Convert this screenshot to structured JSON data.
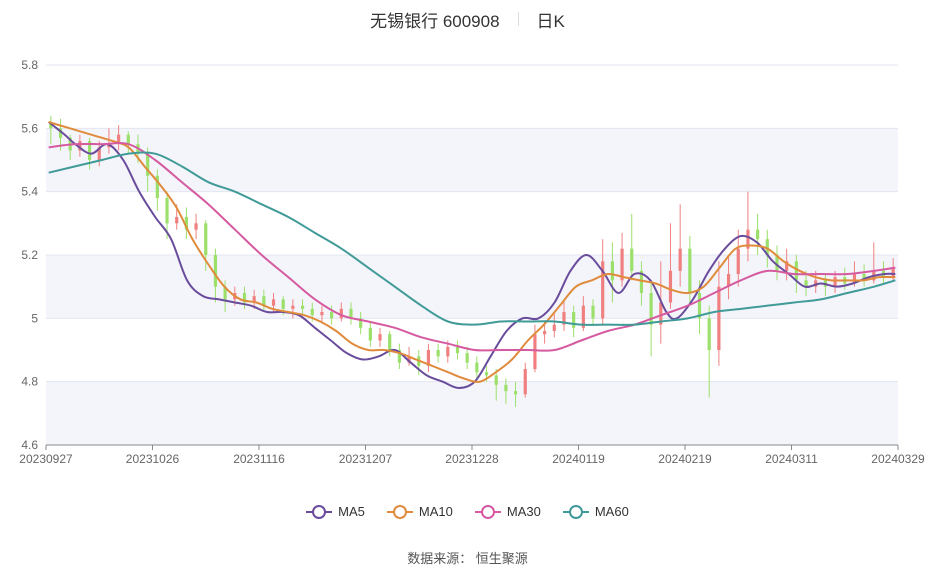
{
  "header": {
    "title": "无锡银行 600908",
    "period": "日K"
  },
  "source": "数据来源：  恒生聚源",
  "chart_data": {
    "type": "candlestick",
    "title": "无锡银行 600908",
    "period_label": "日K",
    "ylim": [
      4.6,
      5.8
    ],
    "y_ticks": [
      4.6,
      4.8,
      5,
      5.2,
      5.4,
      5.6,
      5.8
    ],
    "y_tick_labels": [
      "4.6",
      "4.8",
      "5",
      "5.2",
      "5.4",
      "5.6",
      "5.8"
    ],
    "x_tick_labels": [
      "20230927",
      "20231026",
      "20231116",
      "20231207",
      "20231228",
      "20240119",
      "20240219",
      "20240311",
      "20240329"
    ],
    "x_tick_indices": [
      0,
      20,
      40,
      60,
      80,
      100,
      120,
      140,
      159
    ],
    "grid": true,
    "legend_position": "bottom",
    "colors": {
      "up": "#f08080",
      "down": "#9be06a",
      "MA5": "#6a4c9c",
      "MA10": "#e08b3c",
      "MA30": "#d55aa0",
      "MA60": "#3f9a98"
    },
    "series": [
      {
        "name": "MA5",
        "values": [
          [
            0,
            5.62
          ],
          [
            3,
            5.58
          ],
          [
            5,
            5.55
          ],
          [
            8,
            5.52
          ],
          [
            11,
            5.55
          ],
          [
            14,
            5.5
          ],
          [
            17,
            5.4
          ],
          [
            20,
            5.32
          ],
          [
            23,
            5.25
          ],
          [
            26,
            5.12
          ],
          [
            29,
            5.07
          ],
          [
            32,
            5.06
          ],
          [
            35,
            5.05
          ],
          [
            38,
            5.04
          ],
          [
            41,
            5.02
          ],
          [
            44,
            5.02
          ],
          [
            47,
            5.01
          ],
          [
            50,
            4.97
          ],
          [
            53,
            4.93
          ],
          [
            56,
            4.89
          ],
          [
            59,
            4.87
          ],
          [
            62,
            4.88
          ],
          [
            65,
            4.9
          ],
          [
            68,
            4.86
          ],
          [
            71,
            4.82
          ],
          [
            74,
            4.8
          ],
          [
            77,
            4.78
          ],
          [
            80,
            4.8
          ],
          [
            83,
            4.88
          ],
          [
            86,
            4.96
          ],
          [
            89,
            5.0
          ],
          [
            92,
            5.0
          ],
          [
            95,
            5.05
          ],
          [
            98,
            5.15
          ],
          [
            101,
            5.2
          ],
          [
            104,
            5.15
          ],
          [
            107,
            5.08
          ],
          [
            110,
            5.14
          ],
          [
            113,
            5.12
          ],
          [
            116,
            5.02
          ],
          [
            118,
            5.0
          ],
          [
            121,
            5.06
          ],
          [
            124,
            5.15
          ],
          [
            127,
            5.22
          ],
          [
            130,
            5.26
          ],
          [
            133,
            5.24
          ],
          [
            136,
            5.18
          ],
          [
            139,
            5.14
          ],
          [
            142,
            5.1
          ],
          [
            145,
            5.11
          ],
          [
            148,
            5.1
          ],
          [
            151,
            5.11
          ],
          [
            154,
            5.13
          ],
          [
            157,
            5.14
          ],
          [
            159,
            5.14
          ]
        ]
      },
      {
        "name": "MA10",
        "values": [
          [
            0,
            5.62
          ],
          [
            4,
            5.6
          ],
          [
            8,
            5.58
          ],
          [
            12,
            5.56
          ],
          [
            15,
            5.54
          ],
          [
            18,
            5.48
          ],
          [
            21,
            5.42
          ],
          [
            24,
            5.35
          ],
          [
            27,
            5.25
          ],
          [
            30,
            5.17
          ],
          [
            33,
            5.1
          ],
          [
            36,
            5.06
          ],
          [
            39,
            5.05
          ],
          [
            42,
            5.03
          ],
          [
            45,
            5.02
          ],
          [
            48,
            5.01
          ],
          [
            51,
            4.99
          ],
          [
            54,
            4.96
          ],
          [
            57,
            4.92
          ],
          [
            60,
            4.9
          ],
          [
            63,
            4.9
          ],
          [
            66,
            4.89
          ],
          [
            69,
            4.87
          ],
          [
            72,
            4.85
          ],
          [
            75,
            4.83
          ],
          [
            78,
            4.81
          ],
          [
            81,
            4.8
          ],
          [
            84,
            4.83
          ],
          [
            87,
            4.87
          ],
          [
            90,
            4.93
          ],
          [
            93,
            4.98
          ],
          [
            96,
            5.04
          ],
          [
            99,
            5.1
          ],
          [
            102,
            5.12
          ],
          [
            105,
            5.14
          ],
          [
            108,
            5.13
          ],
          [
            111,
            5.12
          ],
          [
            114,
            5.11
          ],
          [
            117,
            5.09
          ],
          [
            120,
            5.08
          ],
          [
            123,
            5.1
          ],
          [
            126,
            5.16
          ],
          [
            129,
            5.22
          ],
          [
            132,
            5.23
          ],
          [
            135,
            5.22
          ],
          [
            138,
            5.18
          ],
          [
            141,
            5.15
          ],
          [
            144,
            5.13
          ],
          [
            147,
            5.12
          ],
          [
            150,
            5.12
          ],
          [
            153,
            5.12
          ],
          [
            156,
            5.13
          ],
          [
            159,
            5.13
          ]
        ]
      },
      {
        "name": "MA30",
        "values": [
          [
            0,
            5.54
          ],
          [
            5,
            5.55
          ],
          [
            10,
            5.55
          ],
          [
            15,
            5.55
          ],
          [
            20,
            5.5
          ],
          [
            25,
            5.43
          ],
          [
            30,
            5.36
          ],
          [
            35,
            5.28
          ],
          [
            40,
            5.2
          ],
          [
            45,
            5.13
          ],
          [
            50,
            5.06
          ],
          [
            55,
            5.01
          ],
          [
            60,
            4.99
          ],
          [
            65,
            4.97
          ],
          [
            70,
            4.94
          ],
          [
            75,
            4.92
          ],
          [
            80,
            4.9
          ],
          [
            85,
            4.9
          ],
          [
            90,
            4.9
          ],
          [
            95,
            4.9
          ],
          [
            100,
            4.93
          ],
          [
            105,
            4.96
          ],
          [
            110,
            4.98
          ],
          [
            115,
            5.01
          ],
          [
            120,
            5.04
          ],
          [
            125,
            5.08
          ],
          [
            130,
            5.12
          ],
          [
            135,
            5.15
          ],
          [
            140,
            5.14
          ],
          [
            145,
            5.14
          ],
          [
            150,
            5.14
          ],
          [
            155,
            5.15
          ],
          [
            159,
            5.16
          ]
        ]
      },
      {
        "name": "MA60",
        "values": [
          [
            0,
            5.46
          ],
          [
            10,
            5.5
          ],
          [
            15,
            5.52
          ],
          [
            20,
            5.52
          ],
          [
            25,
            5.48
          ],
          [
            30,
            5.43
          ],
          [
            35,
            5.4
          ],
          [
            40,
            5.36
          ],
          [
            45,
            5.32
          ],
          [
            50,
            5.27
          ],
          [
            55,
            5.22
          ],
          [
            60,
            5.16
          ],
          [
            65,
            5.1
          ],
          [
            70,
            5.04
          ],
          [
            75,
            4.99
          ],
          [
            80,
            4.98
          ],
          [
            85,
            4.99
          ],
          [
            90,
            4.99
          ],
          [
            95,
            4.99
          ],
          [
            100,
            4.98
          ],
          [
            105,
            4.98
          ],
          [
            110,
            4.98
          ],
          [
            115,
            4.99
          ],
          [
            120,
            5.0
          ],
          [
            125,
            5.02
          ],
          [
            130,
            5.03
          ],
          [
            135,
            5.04
          ],
          [
            140,
            5.05
          ],
          [
            145,
            5.06
          ],
          [
            150,
            5.08
          ],
          [
            155,
            5.1
          ],
          [
            159,
            5.12
          ]
        ]
      }
    ],
    "candles": [
      [
        5.62,
        5.6,
        5.64,
        5.55
      ],
      [
        5.6,
        5.57,
        5.63,
        5.53
      ],
      [
        5.57,
        5.53,
        5.58,
        5.5
      ],
      [
        5.53,
        5.56,
        5.58,
        5.51
      ],
      [
        5.56,
        5.5,
        5.57,
        5.47
      ],
      [
        5.5,
        5.54,
        5.56,
        5.48
      ],
      [
        5.54,
        5.55,
        5.6,
        5.52
      ],
      [
        5.55,
        5.58,
        5.61,
        5.53
      ],
      [
        5.58,
        5.55,
        5.59,
        5.52
      ],
      [
        5.55,
        5.52,
        5.58,
        5.49
      ],
      [
        5.52,
        5.45,
        5.54,
        5.4
      ],
      [
        5.45,
        5.38,
        5.47,
        5.34
      ],
      [
        5.38,
        5.3,
        5.4,
        5.25
      ],
      [
        5.3,
        5.32,
        5.36,
        5.28
      ],
      [
        5.32,
        5.28,
        5.35,
        5.25
      ],
      [
        5.28,
        5.3,
        5.33,
        5.25
      ],
      [
        5.3,
        5.2,
        5.31,
        5.15
      ],
      [
        5.2,
        5.1,
        5.22,
        5.05
      ],
      [
        5.1,
        5.06,
        5.12,
        5.02
      ],
      [
        5.06,
        5.08,
        5.1,
        5.04
      ],
      [
        5.08,
        5.05,
        5.1,
        5.03
      ],
      [
        5.05,
        5.07,
        5.09,
        5.03
      ],
      [
        5.07,
        5.04,
        5.09,
        5.02
      ],
      [
        5.04,
        5.06,
        5.08,
        5.02
      ],
      [
        5.06,
        5.03,
        5.07,
        5.01
      ],
      [
        5.03,
        5.04,
        5.06,
        5.0
      ],
      [
        5.04,
        5.03,
        5.06,
        5.01
      ],
      [
        5.03,
        5.01,
        5.05,
        4.99
      ],
      [
        5.01,
        5.02,
        5.04,
        4.99
      ],
      [
        5.02,
        5.0,
        5.04,
        4.98
      ],
      [
        5.0,
        5.03,
        5.05,
        4.99
      ],
      [
        5.03,
        5.0,
        5.05,
        4.98
      ],
      [
        5.0,
        4.97,
        5.02,
        4.95
      ],
      [
        4.97,
        4.93,
        4.99,
        4.91
      ],
      [
        4.93,
        4.95,
        4.97,
        4.91
      ],
      [
        4.95,
        4.9,
        4.96,
        4.88
      ],
      [
        4.9,
        4.86,
        4.92,
        4.84
      ],
      [
        4.86,
        4.88,
        4.91,
        4.85
      ],
      [
        4.88,
        4.85,
        4.9,
        4.82
      ],
      [
        4.85,
        4.9,
        4.92,
        4.83
      ],
      [
        4.9,
        4.88,
        4.92,
        4.86
      ],
      [
        4.88,
        4.91,
        4.93,
        4.86
      ],
      [
        4.91,
        4.89,
        4.93,
        4.87
      ],
      [
        4.89,
        4.86,
        4.91,
        4.84
      ],
      [
        4.86,
        4.83,
        4.88,
        4.81
      ],
      [
        4.83,
        4.82,
        4.85,
        4.8
      ],
      [
        4.82,
        4.79,
        4.84,
        4.74
      ],
      [
        4.79,
        4.77,
        4.81,
        4.73
      ],
      [
        4.77,
        4.76,
        4.8,
        4.72
      ],
      [
        4.76,
        4.84,
        4.86,
        4.75
      ],
      [
        4.84,
        4.95,
        4.98,
        4.83
      ],
      [
        4.95,
        4.96,
        4.99,
        4.92
      ],
      [
        4.96,
        4.98,
        5.02,
        4.94
      ],
      [
        4.98,
        5.02,
        5.06,
        4.96
      ],
      [
        5.02,
        4.97,
        5.04,
        4.94
      ],
      [
        4.97,
        5.04,
        5.07,
        4.96
      ],
      [
        5.04,
        5.0,
        5.06,
        4.98
      ],
      [
        5.0,
        5.18,
        5.25,
        4.98
      ],
      [
        5.18,
        5.12,
        5.24,
        5.05
      ],
      [
        5.12,
        5.22,
        5.27,
        5.1
      ],
      [
        5.22,
        5.15,
        5.33,
        5.12
      ],
      [
        5.15,
        5.08,
        5.18,
        5.04
      ],
      [
        5.08,
        4.98,
        5.12,
        4.88
      ],
      [
        4.98,
        5.05,
        5.18,
        4.92
      ],
      [
        5.05,
        5.15,
        5.3,
        5.03
      ],
      [
        5.15,
        5.22,
        5.36,
        5.1
      ],
      [
        5.22,
        5.08,
        5.26,
        5.04
      ],
      [
        5.08,
        5.0,
        5.12,
        4.95
      ],
      [
        5.0,
        4.9,
        5.04,
        4.75
      ],
      [
        4.9,
        5.1,
        5.18,
        4.85
      ],
      [
        5.1,
        5.14,
        5.2,
        5.06
      ],
      [
        5.14,
        5.22,
        5.28,
        5.1
      ],
      [
        5.22,
        5.28,
        5.4,
        5.18
      ],
      [
        5.28,
        5.25,
        5.33,
        5.2
      ],
      [
        5.25,
        5.2,
        5.28,
        5.16
      ],
      [
        5.2,
        5.15,
        5.23,
        5.12
      ],
      [
        5.15,
        5.18,
        5.22,
        5.12
      ],
      [
        5.18,
        5.12,
        5.2,
        5.08
      ],
      [
        5.12,
        5.1,
        5.15,
        5.07
      ],
      [
        5.1,
        5.12,
        5.15,
        5.08
      ],
      [
        5.12,
        5.1,
        5.14,
        5.07
      ],
      [
        5.1,
        5.13,
        5.15,
        5.08
      ],
      [
        5.13,
        5.11,
        5.16,
        5.09
      ],
      [
        5.11,
        5.14,
        5.18,
        5.1
      ],
      [
        5.14,
        5.12,
        5.17,
        5.1
      ],
      [
        5.12,
        5.15,
        5.24,
        5.11
      ],
      [
        5.15,
        5.13,
        5.18,
        5.11
      ],
      [
        5.13,
        5.16,
        5.19,
        5.12
      ]
    ]
  }
}
